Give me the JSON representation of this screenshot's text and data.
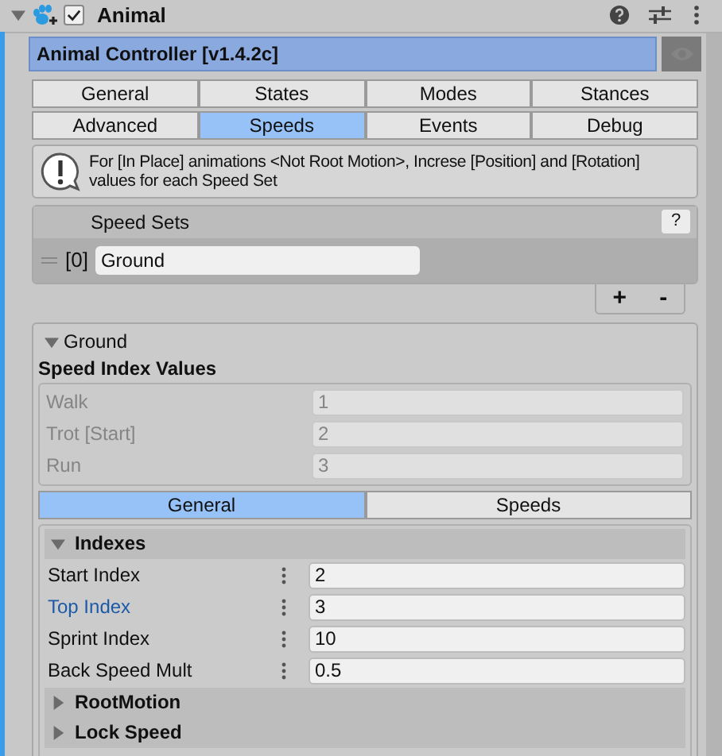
{
  "component": {
    "title": "Animal",
    "enabled": true,
    "expanded": true
  },
  "script_title": "Animal Controller [v1.4.2c]",
  "tabs": [
    {
      "label": "General",
      "selected": false
    },
    {
      "label": "States",
      "selected": false
    },
    {
      "label": "Modes",
      "selected": false
    },
    {
      "label": "Stances",
      "selected": false
    },
    {
      "label": "Advanced",
      "selected": false
    },
    {
      "label": "Speeds",
      "selected": true
    },
    {
      "label": "Events",
      "selected": false
    },
    {
      "label": "Debug",
      "selected": false
    }
  ],
  "help_text": "For [In Place] animations <Not Root Motion>, Increse [Position] and [Rotation] values for each Speed Set",
  "speed_sets": {
    "title": "Speed Sets",
    "help": "?",
    "items": [
      {
        "index": "[0]",
        "value": "Ground"
      }
    ],
    "add": "+",
    "remove": "-"
  },
  "ground": {
    "title": "Ground",
    "expanded": true,
    "subtitle": "Speed Index Values",
    "index_values": [
      {
        "label": "Walk",
        "value": "1"
      },
      {
        "label": "Trot [Start]",
        "value": "2"
      },
      {
        "label": "Run",
        "value": "3"
      }
    ],
    "subtabs": [
      {
        "label": "General",
        "selected": true
      },
      {
        "label": "Speeds",
        "selected": false
      }
    ],
    "sections": [
      {
        "title": "Indexes",
        "expanded": true,
        "fields": [
          {
            "label": "Start Index",
            "value": "2",
            "overridden": false
          },
          {
            "label": "Top Index",
            "value": "3",
            "overridden": true
          },
          {
            "label": "Sprint Index",
            "value": "10",
            "overridden": false
          },
          {
            "label": "Back Speed Mult",
            "value": "0.5",
            "overridden": false
          }
        ]
      },
      {
        "title": "RootMotion",
        "expanded": false
      },
      {
        "title": "Lock Speed",
        "expanded": false
      }
    ]
  }
}
